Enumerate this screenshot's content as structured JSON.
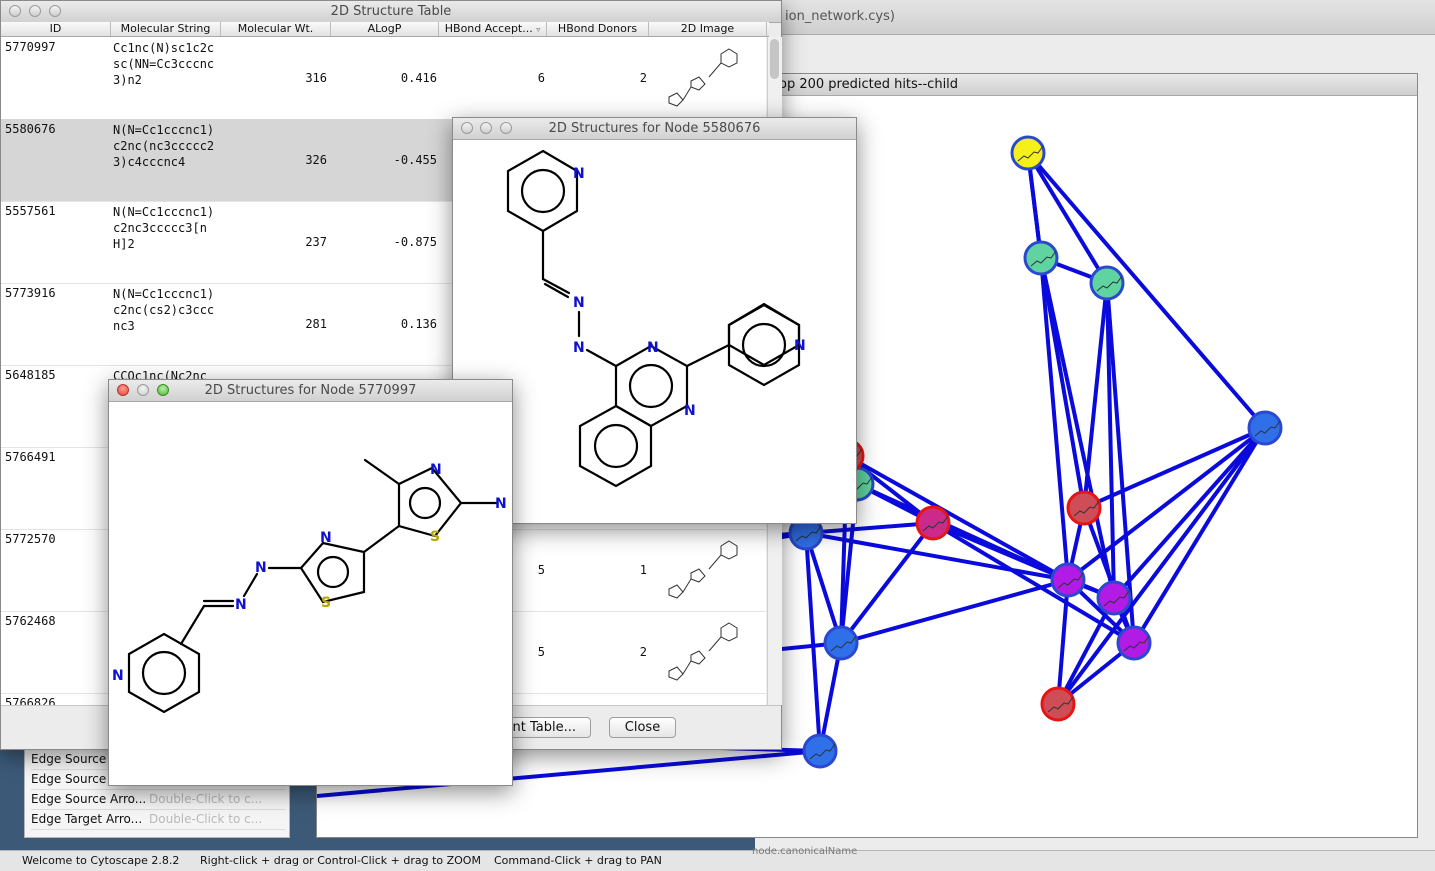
{
  "desktop": {
    "cys_title": "ion_network.cys)"
  },
  "network_window": {
    "title": "op 200 predicted hits--child"
  },
  "edge_panel": {
    "rows": [
      {
        "label": "Edge Source",
        "hint": ""
      },
      {
        "label": "Edge Source",
        "hint": ""
      },
      {
        "label": "Edge Source Arro...",
        "hint": "Double-Click to c..."
      },
      {
        "label": "Edge Target Arro...",
        "hint": "Double-Click to c..."
      }
    ]
  },
  "status": {
    "welcome": "Welcome to Cytoscape 2.8.2",
    "zoom_hint": "Right-click + drag or Control-Click + drag to ZOOM",
    "pan_hint": "Command-Click + drag to PAN",
    "right_text": "node.canonicalName"
  },
  "table_window": {
    "title": "2D Structure Table",
    "columns": [
      "ID",
      "Molecular String",
      "Molecular Wt.",
      "ALogP",
      "HBond Accept...",
      "HBond Donors",
      "2D Image"
    ],
    "rows": [
      {
        "id": "5770997",
        "mol": "Cc1nc(N)sc1c2csc(NN=Cc3cccnc3)n2",
        "wt": "316",
        "alogp": "0.416",
        "acc": "6",
        "don": "2"
      },
      {
        "id": "5580676",
        "mol": "N(N=Cc1cccnc1)c2nc(nc3ccccc23)c4cccnc4",
        "wt": "326",
        "alogp": "-0.455",
        "acc": "",
        "don": ""
      },
      {
        "id": "5557561",
        "mol": "N(N=Cc1cccnc1)c2nc3ccccc3[nH]2",
        "wt": "237",
        "alogp": "-0.875",
        "acc": "",
        "don": ""
      },
      {
        "id": "5773916",
        "mol": "N(N=Cc1cccnc1)c2nc(cs2)c3cccnc3",
        "wt": "281",
        "alogp": "0.136",
        "acc": "",
        "don": ""
      },
      {
        "id": "5648185",
        "mol": "CCOc1nc(Nc2nc(c",
        "wt": "",
        "alogp": "",
        "acc": "",
        "don": ""
      },
      {
        "id": "5766491",
        "mol": "",
        "wt": "",
        "alogp": "",
        "acc": "",
        "don": ""
      },
      {
        "id": "5772570",
        "mol": "",
        "wt": "",
        "alogp": "",
        "acc": "5",
        "don": "1"
      },
      {
        "id": "5762468",
        "mol": "",
        "wt": "",
        "alogp": "",
        "acc": "5",
        "don": "2"
      },
      {
        "id": "5766826",
        "mol": "",
        "wt": "",
        "alogp": "",
        "acc": "",
        "don": ""
      }
    ],
    "export_button": "nt Table...",
    "close_button": "Close"
  },
  "node_window_a": {
    "title": "2D Structures for Node 5580676"
  },
  "node_window_b": {
    "title": "2D Structures for Node 5770997"
  },
  "atom_labels": {
    "N": "N",
    "S": "S"
  },
  "colors": {
    "edge": "#0a0adc",
    "node_yellow": "#f5f01a",
    "node_green": "#5fd3a0",
    "node_blue": "#2f6fe8",
    "node_purple": "#b21ae6",
    "node_pink": "#cc2a8a",
    "node_red_fill": "#cf4d56",
    "node_red_border": "#e81414",
    "atom_n": "#1010d0",
    "atom_s": "#b5a600"
  }
}
